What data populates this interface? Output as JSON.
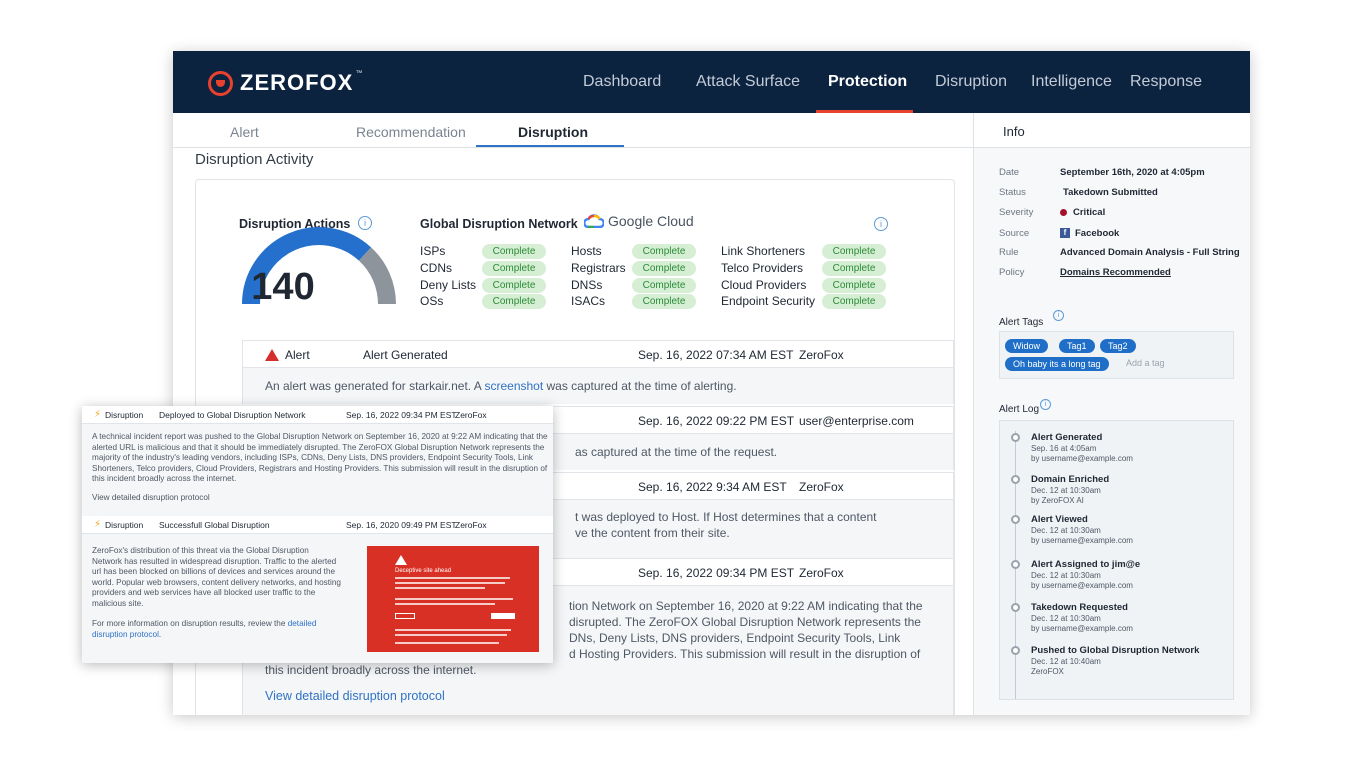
{
  "brand": {
    "name": "ZEROFOX",
    "tm": "™"
  },
  "nav": {
    "items": [
      "Dashboard",
      "Attack Surface",
      "Protection",
      "Disruption",
      "Intelligence",
      "Response"
    ],
    "active": "Protection"
  },
  "tabs": {
    "items": [
      "Alert",
      "Recommendation",
      "Disruption"
    ],
    "active": "Disruption"
  },
  "section_title": "Disruption Activity",
  "actions": {
    "label": "Disruption Actions",
    "count": "140"
  },
  "network": {
    "label": "Global Disruption Network",
    "partner": "Google Cloud",
    "status_label": "Complete",
    "columns": [
      [
        "ISPs",
        "CDNs",
        "Deny Lists",
        "OSs"
      ],
      [
        "Hosts",
        "Registrars",
        "DNSs",
        "ISACs"
      ],
      [
        "Link Shorteners",
        "Telco Providers",
        "Cloud Providers",
        "Endpoint Security"
      ]
    ]
  },
  "activity": [
    {
      "type": "Alert",
      "event": "Alert Generated",
      "date": "Sep. 16, 2022 07:34 AM EST",
      "actor": "ZeroFox",
      "body_pre": "An alert was generated for starkair.net. A ",
      "body_link": "screenshot",
      "body_post": " was captured at the time of alerting."
    },
    {
      "date": "Sep. 16, 2022 09:22 PM EST",
      "actor": "user@enterprise.com",
      "body": "as captured at the time of the request."
    },
    {
      "date": "Sep. 16, 2022 9:34 AM EST",
      "actor": "ZeroFox",
      "body_l1": "t was deployed to Host. If Host determines that a content",
      "body_l2": "ve the content from their site."
    },
    {
      "date": "Sep. 16, 2022 09:34 PM EST",
      "actor": "ZeroFox",
      "body_l1": "tion Network on September 16, 2020 at 9:22 AM indicating that the",
      "body_l2": "disrupted. The ZeroFOX Global Disruption Network represents the",
      "body_l3": "DNs, Deny Lists, DNS providers, Endpoint Security Tools, Link",
      "body_l4": "d Hosting Providers. This submission will result in the disruption of",
      "body_l5": "this incident broadly across the internet.",
      "link": "View detailed disruption protocol"
    }
  ],
  "info": {
    "title": "Info",
    "fields": [
      {
        "k": "Date",
        "v": "September 16th, 2020 at 4:05pm"
      },
      {
        "k": "Status",
        "v": "Takedown Submitted"
      },
      {
        "k": "Severity",
        "v": "Critical"
      },
      {
        "k": "Source",
        "v": "Facebook"
      },
      {
        "k": "Rule",
        "v": "Advanced Domain Analysis - Full String"
      },
      {
        "k": "Policy",
        "v": "Domains Recommended"
      }
    ],
    "tags_title": "Alert Tags",
    "tags": [
      "Widow",
      "Tag1",
      "Tag2",
      "Oh baby its a long tag"
    ],
    "add_tag": "Add a tag",
    "log_title": "Alert Log",
    "log": [
      {
        "t": "Alert Generated",
        "s1": "Sep. 16 at 4:05am",
        "s2": "by username@example.com"
      },
      {
        "t": "Domain Enriched",
        "s1": "Dec. 12 at 10:30am",
        "s2": "by ZeroFOX AI"
      },
      {
        "t": "Alert Viewed",
        "s1": "Dec. 12 at 10:30am",
        "s2": "by username@example.com"
      },
      {
        "t": "Alert Assigned to jim@e",
        "s1": "Dec. 12 at 10:30am",
        "s2": "by username@example.com"
      },
      {
        "t": "Takedown Requested",
        "s1": "Dec. 12 at 10:30am",
        "s2": "by username@example.com"
      },
      {
        "t": "Pushed to Global Disruption Network",
        "s1": "Dec. 12 at 10:40am",
        "s2": "ZeroFOX"
      }
    ]
  },
  "overlay": {
    "row1": {
      "type": "Disruption",
      "event": "Deployed to Global Disruption Network",
      "date": "Sep. 16, 2022 09:34 PM EST",
      "actor": "ZeroFox",
      "l1": "A technical incident report was pushed to the Global Disruption Network on September 16, 2020 at 9:22 AM indicating that the",
      "l2": "alerted URL is malicious and that it should be immediately disrupted. The ZeroFOX Global Disruption Network represents the",
      "l3": "majority of the industry's leading vendors, including ISPs, CDNs, Deny Lists, DNS providers, Endpoint Security Tools, Link",
      "l4": "Shorteners, Telco providers, Cloud Providers, Registrars and Hosting Providers. This submission will result in the disruption of",
      "l5": "this incident broadly across the internet.",
      "link": "View detailed disruption protocol"
    },
    "row2": {
      "type": "Disruption",
      "event": "Successfull Global Disruption",
      "date": "Sep. 16, 2020 09:49 PM EST",
      "actor": "ZeroFox",
      "l1": "ZeroFox's distribution of this threat via the Global Disruption",
      "l2": "Network has resulted in widespread disruption. Traffic to the alerted",
      "l3": "url has been blocked on billions of devices and services around the",
      "l4": "world. Popular web browsers, content delivery networks, and hosting",
      "l5": "providers and web services have all blocked user traffic to the",
      "l6": "malicious site.",
      "m1_pre": "For more information on disruption results, review the ",
      "m1_link": "detailed",
      "m2_link": "disruption protocol",
      "m2_post": ".",
      "red_title": "Deceptive site ahead"
    }
  },
  "colors": {
    "nav_bg": "#0c2340",
    "accent_red": "#e8412e",
    "link_blue": "#2f72c4",
    "complete_green": "#2c8c38",
    "tag_blue": "#1f6fc8",
    "critical": "#a3112a"
  }
}
